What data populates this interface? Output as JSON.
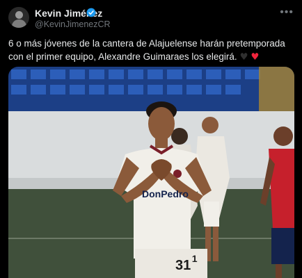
{
  "tweet": {
    "author_name": "Kevin Jiménez",
    "handle": "@KevinJimenezCR",
    "verified": true,
    "more_icon": "more-horizontal-icon",
    "text": "6 o más jóvenes de la cantera de Alajuelense harán pretemporada con el primer equipo, Alexandre Guimaraes los elegirá.",
    "emoji_black_heart": "♥",
    "emoji_red_heart": "♥"
  },
  "photo": {
    "sponsor_text": "DonPedro",
    "shirt_number": "31",
    "colors": {
      "kit_white": "#f1efe9",
      "kit_maroon": "#7a1f2a",
      "opponent_red": "#c6202c",
      "opponent_navy": "#14234d",
      "stands_blue": "#1f4fa8",
      "pitch_green": "#3f4f3a"
    }
  }
}
